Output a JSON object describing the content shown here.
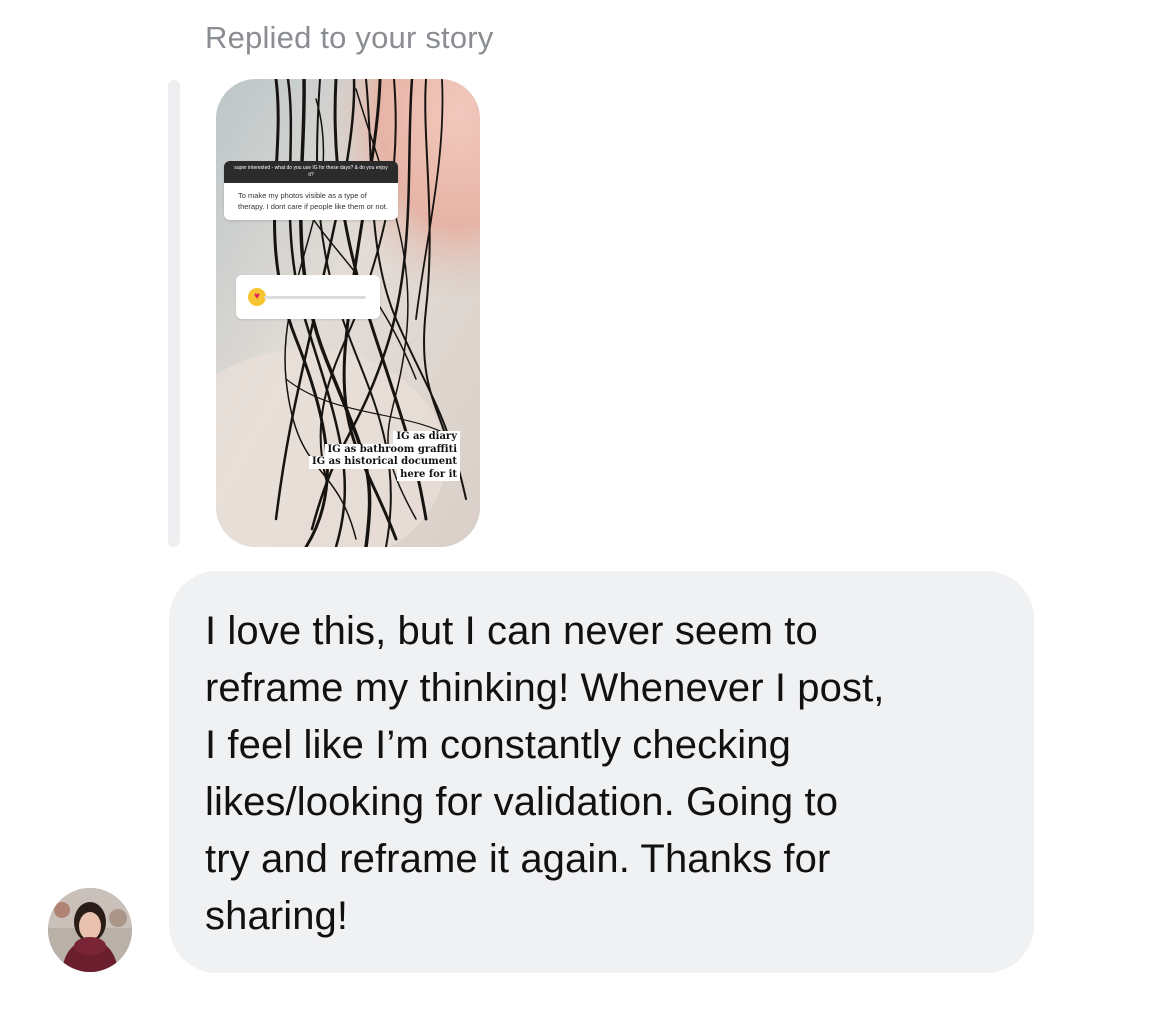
{
  "thread": {
    "reply_context": "Replied to your story"
  },
  "story": {
    "question": "super interested - what do you use IG for these days? & do you enjoy it?",
    "answer": "To make my photos visible as a type of therapy. I dont care if people like them or not.",
    "slider_emoji_icon": "heart-eyes-emoji",
    "captions": [
      "IG as diary",
      "IG as bathroom graffiti",
      "IG as historical document",
      "here for it"
    ]
  },
  "message": {
    "text": "I love this, but I can never seem to\nreframe my thinking! Whenever I post,\nI feel like I’m constantly checking\nlikes/looking for validation. Going to\ntry and reframe it again. Thanks for\nsharing!"
  },
  "colors": {
    "bubble_bg": "#f0f1f3",
    "header_text": "#8a8d91",
    "quote_bar": "#efeff1"
  }
}
